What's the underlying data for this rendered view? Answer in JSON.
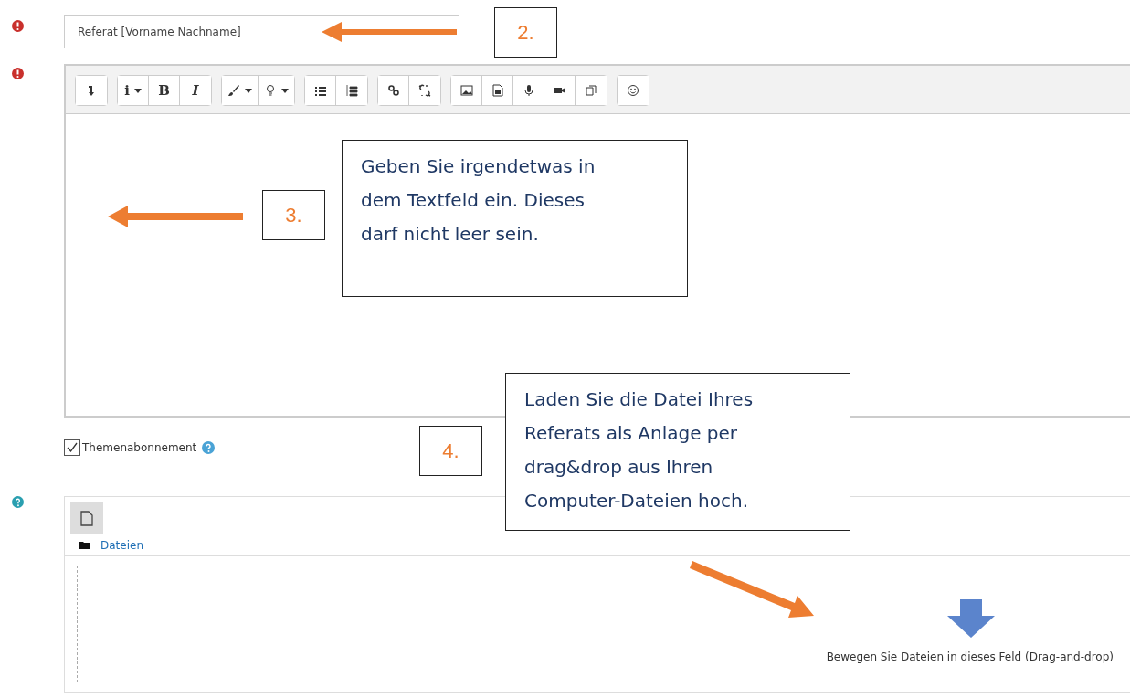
{
  "subject": {
    "required": true,
    "value": "Referat [Vorname Nachname]"
  },
  "message": {
    "required": true,
    "toolbar_labels": [
      "i",
      "B",
      "I"
    ]
  },
  "subscription": {
    "checked": true,
    "label": "Themenabonnement"
  },
  "attachments": {
    "folder": "Dateien",
    "drop_hint": "Bewegen Sie Dateien in dieses Feld (Drag-and-drop)"
  },
  "annotations": [
    {
      "number": "2."
    },
    {
      "number": "3.",
      "text": "Geben Sie irgendetwas in dem Textfeld ein. Dieses darf nicht leer sein."
    },
    {
      "number": "4.",
      "text": "Laden Sie die Datei Ihres Referats als Anlage per drag&drop aus Ihren Computer-Dateien hoch."
    }
  ]
}
